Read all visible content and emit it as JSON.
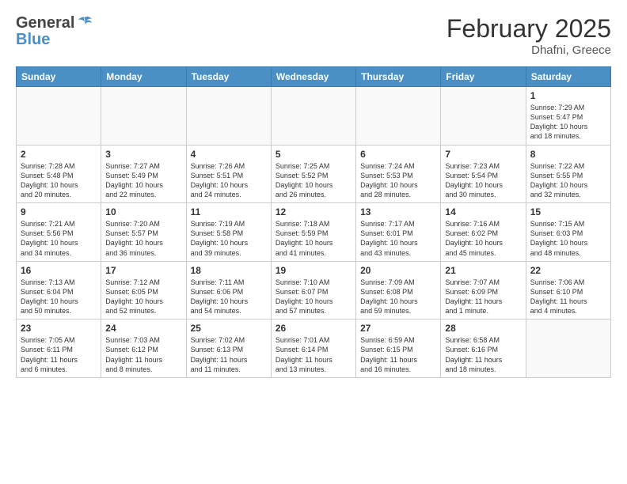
{
  "header": {
    "logo": {
      "general": "General",
      "blue": "Blue"
    },
    "title": "February 2025",
    "location": "Dhafni, Greece"
  },
  "weekdays": [
    "Sunday",
    "Monday",
    "Tuesday",
    "Wednesday",
    "Thursday",
    "Friday",
    "Saturday"
  ],
  "weeks": [
    [
      {
        "day": "",
        "info": ""
      },
      {
        "day": "",
        "info": ""
      },
      {
        "day": "",
        "info": ""
      },
      {
        "day": "",
        "info": ""
      },
      {
        "day": "",
        "info": ""
      },
      {
        "day": "",
        "info": ""
      },
      {
        "day": "1",
        "info": "Sunrise: 7:29 AM\nSunset: 5:47 PM\nDaylight: 10 hours\nand 18 minutes."
      }
    ],
    [
      {
        "day": "2",
        "info": "Sunrise: 7:28 AM\nSunset: 5:48 PM\nDaylight: 10 hours\nand 20 minutes."
      },
      {
        "day": "3",
        "info": "Sunrise: 7:27 AM\nSunset: 5:49 PM\nDaylight: 10 hours\nand 22 minutes."
      },
      {
        "day": "4",
        "info": "Sunrise: 7:26 AM\nSunset: 5:51 PM\nDaylight: 10 hours\nand 24 minutes."
      },
      {
        "day": "5",
        "info": "Sunrise: 7:25 AM\nSunset: 5:52 PM\nDaylight: 10 hours\nand 26 minutes."
      },
      {
        "day": "6",
        "info": "Sunrise: 7:24 AM\nSunset: 5:53 PM\nDaylight: 10 hours\nand 28 minutes."
      },
      {
        "day": "7",
        "info": "Sunrise: 7:23 AM\nSunset: 5:54 PM\nDaylight: 10 hours\nand 30 minutes."
      },
      {
        "day": "8",
        "info": "Sunrise: 7:22 AM\nSunset: 5:55 PM\nDaylight: 10 hours\nand 32 minutes."
      }
    ],
    [
      {
        "day": "9",
        "info": "Sunrise: 7:21 AM\nSunset: 5:56 PM\nDaylight: 10 hours\nand 34 minutes."
      },
      {
        "day": "10",
        "info": "Sunrise: 7:20 AM\nSunset: 5:57 PM\nDaylight: 10 hours\nand 36 minutes."
      },
      {
        "day": "11",
        "info": "Sunrise: 7:19 AM\nSunset: 5:58 PM\nDaylight: 10 hours\nand 39 minutes."
      },
      {
        "day": "12",
        "info": "Sunrise: 7:18 AM\nSunset: 5:59 PM\nDaylight: 10 hours\nand 41 minutes."
      },
      {
        "day": "13",
        "info": "Sunrise: 7:17 AM\nSunset: 6:01 PM\nDaylight: 10 hours\nand 43 minutes."
      },
      {
        "day": "14",
        "info": "Sunrise: 7:16 AM\nSunset: 6:02 PM\nDaylight: 10 hours\nand 45 minutes."
      },
      {
        "day": "15",
        "info": "Sunrise: 7:15 AM\nSunset: 6:03 PM\nDaylight: 10 hours\nand 48 minutes."
      }
    ],
    [
      {
        "day": "16",
        "info": "Sunrise: 7:13 AM\nSunset: 6:04 PM\nDaylight: 10 hours\nand 50 minutes."
      },
      {
        "day": "17",
        "info": "Sunrise: 7:12 AM\nSunset: 6:05 PM\nDaylight: 10 hours\nand 52 minutes."
      },
      {
        "day": "18",
        "info": "Sunrise: 7:11 AM\nSunset: 6:06 PM\nDaylight: 10 hours\nand 54 minutes."
      },
      {
        "day": "19",
        "info": "Sunrise: 7:10 AM\nSunset: 6:07 PM\nDaylight: 10 hours\nand 57 minutes."
      },
      {
        "day": "20",
        "info": "Sunrise: 7:09 AM\nSunset: 6:08 PM\nDaylight: 10 hours\nand 59 minutes."
      },
      {
        "day": "21",
        "info": "Sunrise: 7:07 AM\nSunset: 6:09 PM\nDaylight: 11 hours\nand 1 minute."
      },
      {
        "day": "22",
        "info": "Sunrise: 7:06 AM\nSunset: 6:10 PM\nDaylight: 11 hours\nand 4 minutes."
      }
    ],
    [
      {
        "day": "23",
        "info": "Sunrise: 7:05 AM\nSunset: 6:11 PM\nDaylight: 11 hours\nand 6 minutes."
      },
      {
        "day": "24",
        "info": "Sunrise: 7:03 AM\nSunset: 6:12 PM\nDaylight: 11 hours\nand 8 minutes."
      },
      {
        "day": "25",
        "info": "Sunrise: 7:02 AM\nSunset: 6:13 PM\nDaylight: 11 hours\nand 11 minutes."
      },
      {
        "day": "26",
        "info": "Sunrise: 7:01 AM\nSunset: 6:14 PM\nDaylight: 11 hours\nand 13 minutes."
      },
      {
        "day": "27",
        "info": "Sunrise: 6:59 AM\nSunset: 6:15 PM\nDaylight: 11 hours\nand 16 minutes."
      },
      {
        "day": "28",
        "info": "Sunrise: 6:58 AM\nSunset: 6:16 PM\nDaylight: 11 hours\nand 18 minutes."
      },
      {
        "day": "",
        "info": ""
      }
    ]
  ]
}
